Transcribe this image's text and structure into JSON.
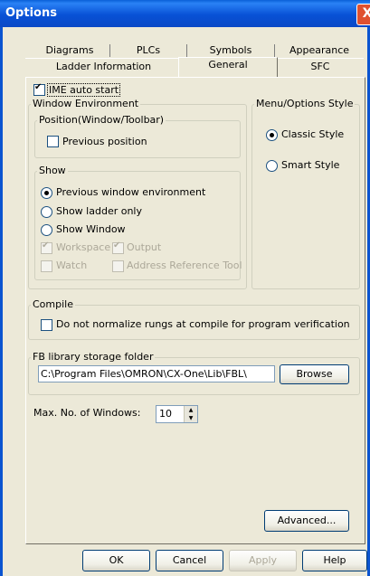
{
  "window": {
    "title": "Options",
    "close_glyph": "X"
  },
  "tabs_row1": [
    "Diagrams",
    "PLCs",
    "Symbols",
    "Appearance"
  ],
  "tabs_row2": [
    "Ladder Information",
    "General",
    "SFC"
  ],
  "active_tab": "General",
  "general": {
    "ime_auto_start": {
      "label": "IME auto start",
      "checked": true
    },
    "window_environment": {
      "title": "Window Environment",
      "position_group": {
        "title": "Position(Window/Toolbar)",
        "previous_position": {
          "label": "Previous position",
          "checked": false
        }
      },
      "show_group": {
        "title": "Show",
        "options": [
          {
            "label": "Previous window environment",
            "selected": true
          },
          {
            "label": "Show ladder only",
            "selected": false
          },
          {
            "label": "Show Window",
            "selected": false
          }
        ],
        "workspace": {
          "label": "Workspace",
          "checked": true,
          "disabled": true
        },
        "output": {
          "label": "Output",
          "checked": true,
          "disabled": true
        },
        "watch": {
          "label": "Watch",
          "checked": false,
          "disabled": true
        },
        "address_reference_tool": {
          "label": "Address Reference Tool",
          "checked": false,
          "disabled": true
        }
      }
    },
    "menu_options_style": {
      "title": "Menu/Options Style",
      "classic": {
        "label": "Classic Style",
        "selected": true
      },
      "smart": {
        "label": "Smart Style",
        "selected": false
      }
    },
    "compile": {
      "title": "Compile",
      "normalize": {
        "label": "Do not normalize rungs at compile for program verification",
        "checked": false
      }
    },
    "fb_library": {
      "title": "FB library storage folder",
      "path": "C:\\Program Files\\OMRON\\CX-One\\Lib\\FBL\\",
      "browse_label": "Browse"
    },
    "max_windows": {
      "label": "Max. No. of Windows:",
      "value": "10"
    },
    "advanced_label": "Advanced..."
  },
  "footer": {
    "ok": "OK",
    "cancel": "Cancel",
    "apply": "Apply",
    "help": "Help"
  }
}
